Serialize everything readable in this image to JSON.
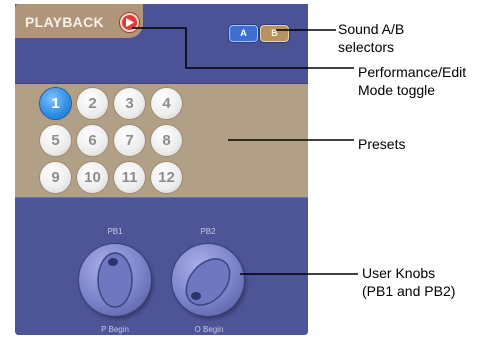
{
  "panel": {
    "title": "PLAYBACK",
    "sound_a_label": "A",
    "sound_b_label": "B"
  },
  "presets": {
    "items": [
      "1",
      "2",
      "3",
      "4",
      "5",
      "6",
      "7",
      "8",
      "9",
      "10",
      "11",
      "12"
    ],
    "selected": "1"
  },
  "knobs": {
    "pb1": {
      "label": "PB1",
      "value": "P Begin"
    },
    "pb2": {
      "label": "PB2",
      "value": "O Begin"
    }
  },
  "annotations": {
    "sound_ab": [
      "Sound A/B",
      "selectors"
    ],
    "mode_toggle": [
      "Performance/Edit",
      "Mode toggle"
    ],
    "presets": [
      "Presets"
    ],
    "user_knobs": [
      "User Knobs",
      "(PB1 and PB2)"
    ]
  },
  "colors": {
    "panel_blue": "#525a9c",
    "tan": "#b19f86",
    "active_preset": "#2f8de4",
    "mode_toggle_red": "#e8393a",
    "sound_a_blue": "#3e6fd3",
    "sound_b_gold": "#b9935f"
  },
  "icons": {
    "mode_toggle": "play-icon"
  }
}
